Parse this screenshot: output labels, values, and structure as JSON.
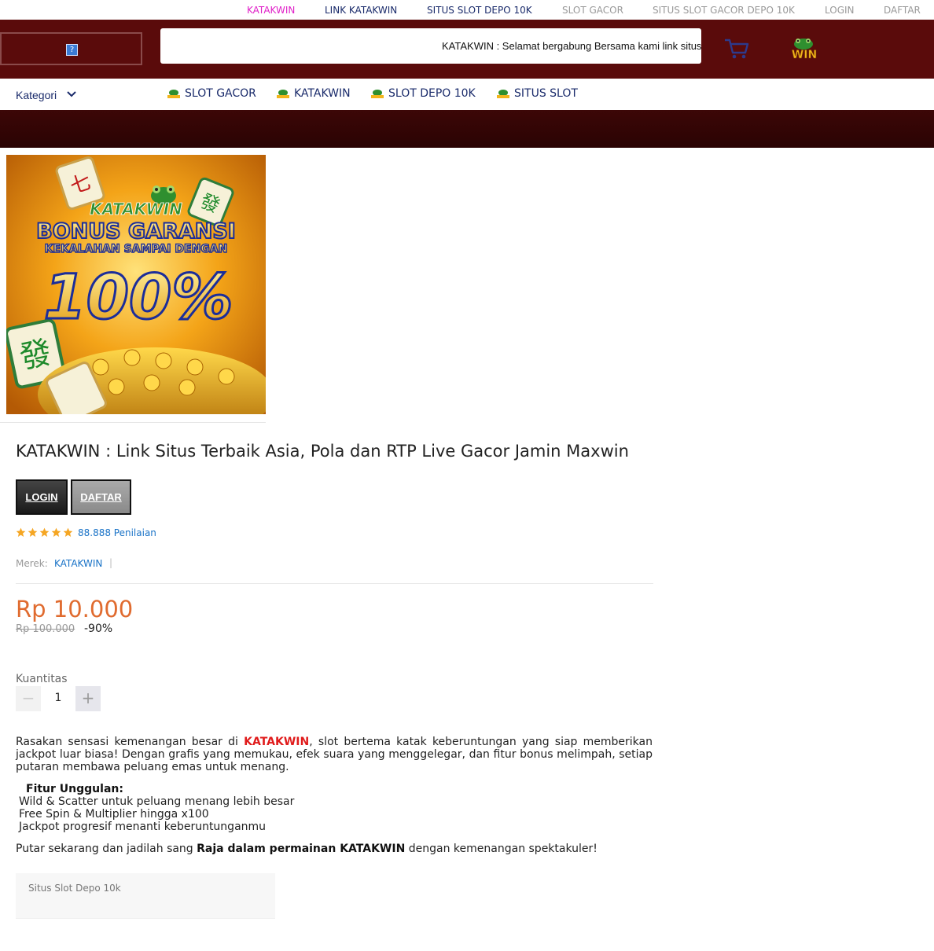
{
  "topbar": {
    "links": [
      {
        "label": "KATAKWIN",
        "color": "#e020c8"
      },
      {
        "label": "LINK KATAKWIN",
        "color": "#1a2b6b"
      },
      {
        "label": "SITUS SLOT DEPO 10K",
        "color": "#1a2b6b"
      },
      {
        "label": "SLOT GACOR",
        "color": "#999999"
      },
      {
        "label": "SITUS SLOT GACOR DEPO 10K",
        "color": "#999999"
      },
      {
        "label": "LOGIN",
        "color": "#999999"
      },
      {
        "label": "DAFTAR",
        "color": "#999999"
      }
    ]
  },
  "header": {
    "broken_image_icon": "question-mark-icon",
    "marquee_text": "KATAKWIN : Selamat bergabung Bersama kami link situs",
    "cart_icon": "cart-icon",
    "logo_text": "WIN"
  },
  "nav": {
    "kategori_label": "Kategori",
    "items": [
      "SLOT GACOR",
      "KATAKWIN",
      "SLOT DEPO 10K",
      "SITUS SLOT"
    ]
  },
  "banner": {
    "brand": "KATAKWIN",
    "line1": "BONUS GARANSI",
    "line2": "KEKALAHAN SAMPAI DENGAN",
    "percent": "100%"
  },
  "product": {
    "title": "KATAKWIN : Link Situs Terbaik Asia, Pola dan RTP Live Gacor Jamin Maxwin",
    "login_label": "LOGIN",
    "daftar_label": "DAFTAR",
    "stars": 5,
    "rating_text": "88.888 Penilaian",
    "merek_label": "Merek:",
    "merek_value": "KATAKWIN",
    "merek_sep": "|",
    "price": "Rp 10.000",
    "old_price": "Rp 100.000",
    "discount": "-90%",
    "qty_label": "Kuantitas",
    "qty_value": "1",
    "qty_minus": "−",
    "qty_plus": "+"
  },
  "description": {
    "p1_before": "Rasakan sensasi kemenangan besar di ",
    "p1_brand": "KATAKWIN",
    "p1_after": ", slot bertema katak keberuntungan yang siap memberikan jackpot luar biasa! Dengan grafis yang memukau, efek suara yang menggelegar, dan fitur bonus melimpah, setiap putaran membawa peluang emas untuk menang.",
    "fitur_heading": "Fitur Unggulan:",
    "features": [
      "Wild & Scatter untuk peluang menang lebih besar",
      "Free Spin & Multiplier hingga x100",
      "Jackpot progresif menanti keberuntunganmu"
    ],
    "outro_before": "Putar sekarang dan jadilah sang ",
    "outro_bold": "Raja dalam permainan KATAKWIN",
    "outro_after": " dengan kemenangan spektakuler!"
  },
  "tag": {
    "label": "Situs Slot Depo 10k"
  },
  "colors": {
    "header_bg": "#5a0b0b",
    "price": "#e06b2f",
    "link_blue": "#1a73c7",
    "nav_text": "#1a2b6b",
    "brand_red": "#e01b1b"
  }
}
